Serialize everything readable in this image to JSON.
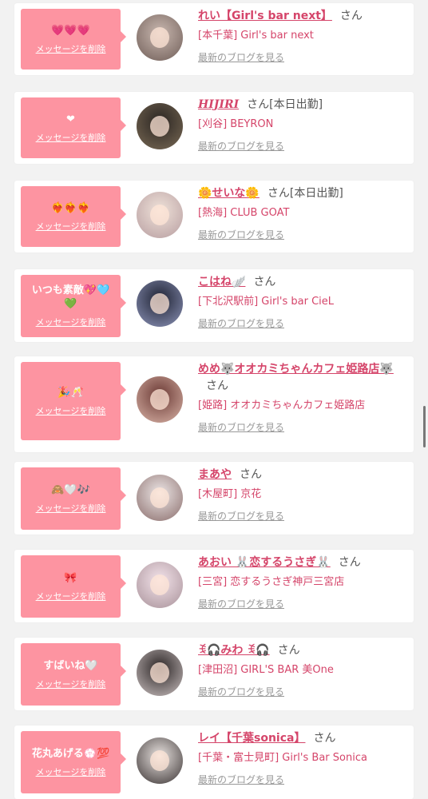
{
  "colors": {
    "accent": "#d5456a",
    "bubble": "#fd94a1",
    "page_bg": "#f2f2f2"
  },
  "common": {
    "delete_label": "メッセージを削除",
    "blog_label": "最新のブログを見る",
    "san": "さん"
  },
  "cards": [
    {
      "message": "💗💗💗",
      "name": "れい【Girl's bar next】",
      "attendance": "",
      "shop": "[本千葉] Girl's bar next",
      "name_italic": false,
      "avatar_colors": [
        "#c9b8b0",
        "#6f5d57"
      ]
    },
    {
      "message": "❤",
      "name": "HIJIRI",
      "attendance": "[本日出勤]",
      "shop": "[刈谷] BEYRON",
      "name_italic": true,
      "avatar_colors": [
        "#2a2522",
        "#7a6a55"
      ]
    },
    {
      "message": "❤️‍🔥❤️‍🔥❤️‍🔥",
      "name": "🌼せいな🌼",
      "attendance": "[本日出勤]",
      "shop": "[熱海] CLUB GOAT",
      "name_italic": false,
      "avatar_colors": [
        "#efe2d9",
        "#b79da0"
      ]
    },
    {
      "message": "いつも素敵💖🩵💚",
      "name": "こはね🪽",
      "attendance": "",
      "shop": "[下北沢駅前] Girl's bar CieL",
      "name_italic": false,
      "avatar_colors": [
        "#1f2333",
        "#8c93b8"
      ]
    },
    {
      "message": "🎉🥂",
      "name": "めめ🐺オオカミちゃんカフェ姫路店🐺",
      "attendance": "",
      "shop": "[姫路] オオカミちゃんカフェ姫路店",
      "name_italic": false,
      "avatar_colors": [
        "#6b3a35",
        "#d9b3a7"
      ]
    },
    {
      "message": "🙈🤍🎶",
      "name": "まあや",
      "attendance": "",
      "shop": "[木屋町] 京花",
      "name_italic": false,
      "avatar_colors": [
        "#ece6e6",
        "#8a6d6b"
      ]
    },
    {
      "message": "🎀",
      "name": "あおい 🐰恋するうさぎ🐰",
      "attendance": "",
      "shop": "[三宮] 恋するうさぎ神戸三宮店",
      "name_italic": false,
      "avatar_colors": [
        "#f3e3ea",
        "#a89199"
      ]
    },
    {
      "message": "すばいね🤍",
      "name": "ꉂ🎧みわ ꉂ🎧",
      "attendance": "",
      "shop": "[津田沼] GIRL'S BAR 美One",
      "name_italic": false,
      "avatar_colors": [
        "#2b2525",
        "#c9bfbf"
      ]
    },
    {
      "message": "花丸あげる💮💯",
      "name": "レイ【千葉sonica】",
      "attendance": "",
      "shop": "[千葉・富士見町] Girl's Bar Sonica",
      "name_italic": false,
      "avatar_colors": [
        "#e8e2df",
        "#3a3333"
      ]
    }
  ]
}
